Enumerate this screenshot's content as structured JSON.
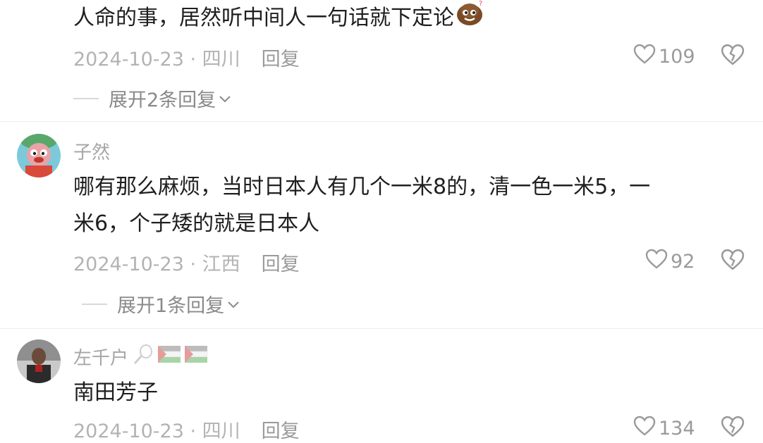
{
  "comment1": {
    "text": "人命的事，居然听中间人一句话就下定论",
    "date": "2024-10-23 · 四川",
    "reply_label": "回复",
    "likes": "109",
    "expand_label": "展开2条回复"
  },
  "comment2": {
    "username": "子然",
    "text_line1": "哪有那么麻烦，当时日本人有几个一米8的，清一色一米5，一",
    "text_line2": "米6，个子矮的就是日本人",
    "date": "2024-10-23 · 江西",
    "reply_label": "回复",
    "likes": "92",
    "expand_label": "展开1条回复"
  },
  "comment3": {
    "username": "左千户",
    "text": "南田芳子",
    "date": "2024-10-23 · 四川",
    "reply_label": "回复",
    "likes": "134"
  },
  "colors": {
    "text": "#1f1f1f",
    "meta": "#b3b3b3",
    "icon": "#9a9a9a"
  }
}
